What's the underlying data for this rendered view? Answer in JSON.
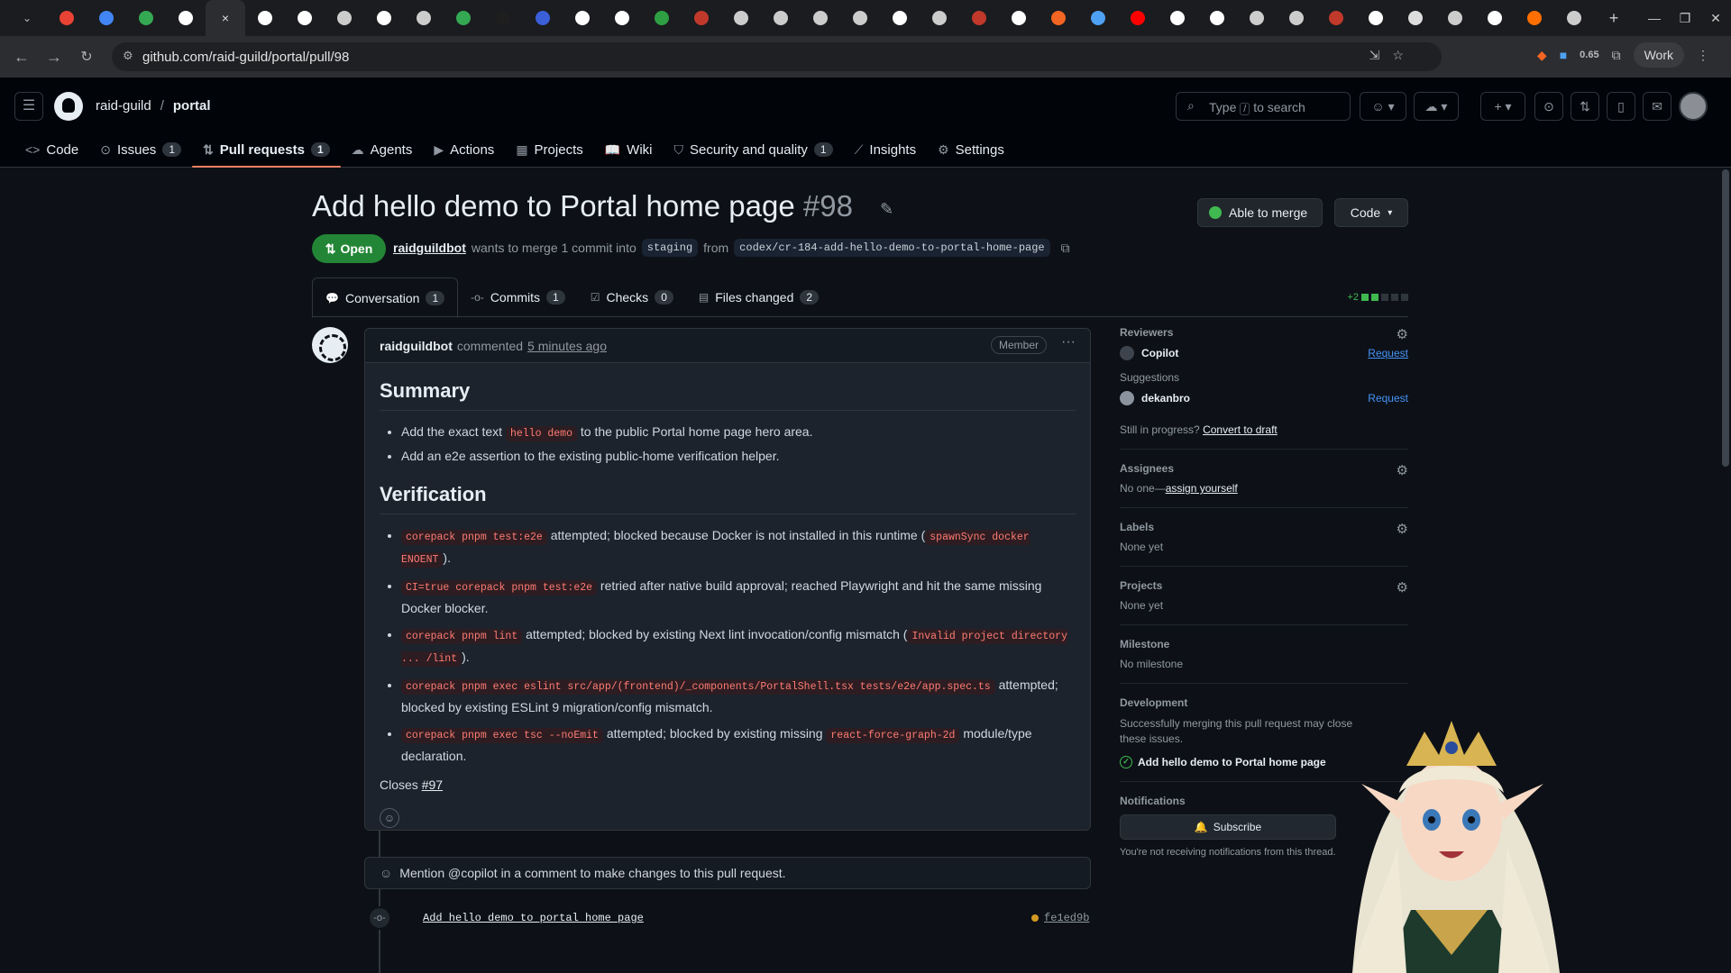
{
  "browser": {
    "tab_icon_colors": [
      "#ea4335",
      "#4285f4",
      "#34a853",
      "#ffffff",
      "#ffffff",
      "#ffffff",
      "#cccccc",
      "#ffffff",
      "#cccccc",
      "#34a853",
      "#1e1e1e",
      "#3b5ed9",
      "#ffffff",
      "#ffffff",
      "#2ea043",
      "#c0392b",
      "#cccccc",
      "#cccccc",
      "#cccccc",
      "#cccccc",
      "#ffffff",
      "#cccccc",
      "#c0392b",
      "#ffffff",
      "#f26522",
      "#4ea1f3",
      "#ff0000",
      "#ffffff",
      "#ffffff",
      "#cccccc",
      "#cccccc",
      "#c0392b",
      "#ffffff",
      "#dddddd",
      "#cccccc",
      "#ffffff",
      "#ff6f00",
      "#cccccc"
    ],
    "active_tab_close": "×",
    "new_tab": "+",
    "url": "github.com/raid-guild/portal/pull/98",
    "extension_value": "0.65",
    "profile_label": "Work"
  },
  "header": {
    "owner": "raid-guild",
    "separator": "/",
    "repo": "portal",
    "search_pre": "Type",
    "search_key": "/",
    "search_post": "to search"
  },
  "repo_tabs": [
    {
      "label": "Code",
      "icon": "code-icon",
      "glyph": "<>",
      "count": ""
    },
    {
      "label": "Issues",
      "icon": "issue-icon",
      "glyph": "⊙",
      "count": "1"
    },
    {
      "label": "Pull requests",
      "icon": "pull-request-icon",
      "glyph": "⇅",
      "count": "1"
    },
    {
      "label": "Agents",
      "icon": "agents-icon",
      "glyph": "☁",
      "count": ""
    },
    {
      "label": "Actions",
      "icon": "actions-icon",
      "glyph": "▶",
      "count": ""
    },
    {
      "label": "Projects",
      "icon": "projects-icon",
      "glyph": "▦",
      "count": ""
    },
    {
      "label": "Wiki",
      "icon": "wiki-icon",
      "glyph": "📖",
      "count": ""
    },
    {
      "label": "Security and quality",
      "icon": "shield-icon",
      "glyph": "⛉",
      "count": "1"
    },
    {
      "label": "Insights",
      "icon": "graph-icon",
      "glyph": "⟋",
      "count": ""
    },
    {
      "label": "Settings",
      "icon": "gear-icon",
      "glyph": "⚙",
      "count": ""
    }
  ],
  "pr": {
    "title": "Add hello demo to Portal home page",
    "number": "#98",
    "merge_status": "Able to merge",
    "code_button": "Code",
    "state": "Open",
    "author": "raidguildbot",
    "meta_text": "wants to merge 1 commit into",
    "base_branch": "staging",
    "from_text": "from",
    "head_branch": "codex/cr-184-add-hello-demo-to-portal-home-page",
    "diffstat": "+2"
  },
  "pr_tabs": [
    {
      "label": "Conversation",
      "icon": "comment-icon",
      "glyph": "💬",
      "count": "1"
    },
    {
      "label": "Commits",
      "icon": "commit-icon",
      "glyph": "-o-",
      "count": "1"
    },
    {
      "label": "Checks",
      "icon": "checks-icon",
      "glyph": "☑",
      "count": "0"
    },
    {
      "label": "Files changed",
      "icon": "file-diff-icon",
      "glyph": "▤",
      "count": "2"
    }
  ],
  "comment": {
    "author": "raidguildbot",
    "action": "commented",
    "time": "5 minutes ago",
    "badge": "Member",
    "summary_heading": "Summary",
    "summary_items": [
      {
        "pre": "Add the exact text ",
        "code": "hello demo",
        "post": " to the public Portal home page hero area."
      },
      {
        "pre": "Add an e2e assertion to the existing public-home verification helper.",
        "code": "",
        "post": ""
      }
    ],
    "verification_heading": "Verification",
    "verification_items": [
      {
        "code1": "corepack pnpm test:e2e",
        "mid": " attempted; blocked because Docker is not installed in this runtime (",
        "code2": "spawnSync docker ENOENT",
        "post": ")."
      },
      {
        "code1": "CI=true corepack pnpm test:e2e",
        "mid": " retried after native build approval; reached Playwright and hit the same missing Docker blocker.",
        "code2": "",
        "post": ""
      },
      {
        "code1": "corepack pnpm lint",
        "mid": " attempted; blocked by existing Next lint invocation/config mismatch (",
        "code2": "Invalid project directory ... /lint",
        "post": ")."
      },
      {
        "code1": "corepack pnpm exec eslint src/app/(frontend)/_components/PortalShell.tsx tests/e2e/app.spec.ts",
        "mid": " attempted; blocked by existing ESLint 9 migration/config mismatch.",
        "code2": "",
        "post": ""
      },
      {
        "code1": "corepack pnpm exec tsc --noEmit",
        "mid": " attempted; blocked by existing missing ",
        "code2": "react-force-graph-2d",
        "post": " module/type declaration."
      }
    ],
    "closes_label": "Closes",
    "closes_ref": "#97"
  },
  "copilot_hint": "Mention @copilot in a comment to make changes to this pull request.",
  "commit": {
    "message": "Add hello demo to portal home page",
    "sha": "fe1ed9b"
  },
  "sidebar": {
    "reviewers_label": "Reviewers",
    "reviewer": "Copilot",
    "request": "Request",
    "suggestions_label": "Suggestions",
    "suggested": "dekanbro",
    "in_progress": "Still in progress?",
    "convert_draft": "Convert to draft",
    "assignees_label": "Assignees",
    "assignees_none": "No one—",
    "assign_yourself": "assign yourself",
    "labels_label": "Labels",
    "labels_none": "None yet",
    "projects_label": "Projects",
    "projects_none": "None yet",
    "milestone_label": "Milestone",
    "milestone_none": "No milestone",
    "development_label": "Development",
    "development_text": "Successfully merging this pull request may close these issues.",
    "development_issue": "Add hello demo to Portal home page",
    "notifications_label": "Notifications",
    "subscribe": "Subscribe",
    "notif_text": "You're not receiving notifications from this thread."
  }
}
